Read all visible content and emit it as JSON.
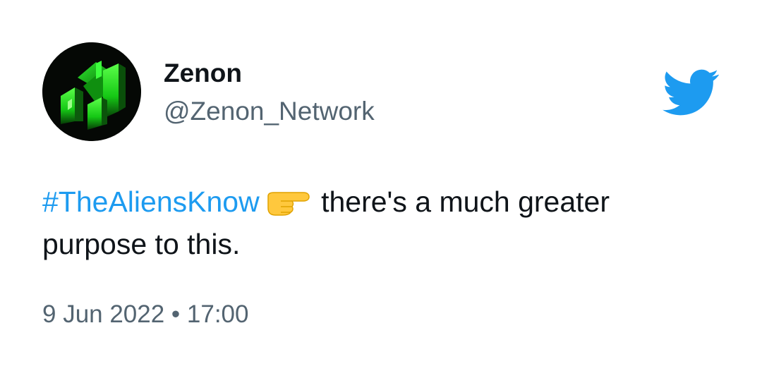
{
  "tweet": {
    "display_name": "Zenon",
    "handle": "@Zenon_Network",
    "hashtag": "#TheAliensKnow",
    "emoji_icon": "backhand-index-pointing-right-icon",
    "text_after_emoji": " there's a much greater purpose to this.",
    "timestamp": "9 Jun 2022 • 17:00"
  },
  "colors": {
    "hashtag": "#1d9bf0",
    "twitter_logo": "#1d9bf0",
    "secondary_text": "#536471",
    "avatar_background": "#050805",
    "avatar_accent": "#22ff22"
  }
}
